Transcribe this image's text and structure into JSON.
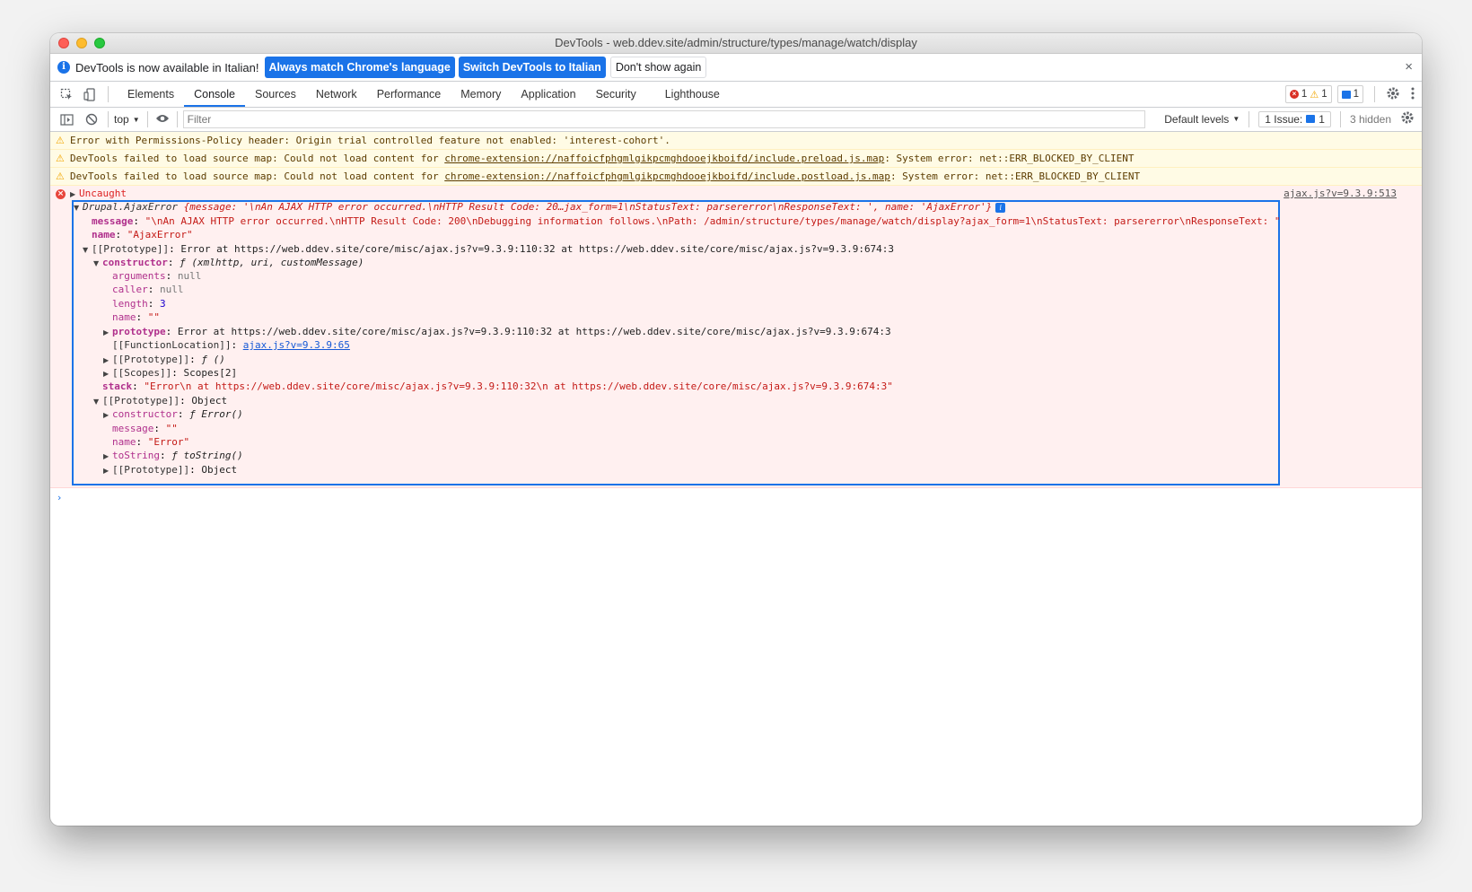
{
  "window": {
    "title": "DevTools - web.ddev.site/admin/structure/types/manage/watch/display"
  },
  "infobar": {
    "message": "DevTools is now available in Italian!",
    "btn_match": "Always match Chrome's language",
    "btn_switch": "Switch DevTools to Italian",
    "btn_dismiss": "Don't show again",
    "close": "×"
  },
  "tabs": [
    {
      "label": "Elements"
    },
    {
      "label": "Console"
    },
    {
      "label": "Sources"
    },
    {
      "label": "Network"
    },
    {
      "label": "Performance"
    },
    {
      "label": "Memory"
    },
    {
      "label": "Application"
    },
    {
      "label": "Security"
    },
    {
      "label": "Lighthouse"
    }
  ],
  "counters": {
    "errors": "1",
    "warnings": "1",
    "messages": "1"
  },
  "toolbar": {
    "context": "top",
    "filter_placeholder": "Filter",
    "levels": "Default levels",
    "issues_label": "1 Issue:",
    "issues_count": "1",
    "hidden": "3 hidden"
  },
  "warnings": [
    {
      "pre": "Error with Permissions-Policy header: Origin trial controlled feature not enabled: 'interest-cohort'.",
      "link": "",
      "post": ""
    },
    {
      "pre": "DevTools failed to load source map: Could not load content for ",
      "link": "chrome-extension://naffoicfphgmlgikpcmghdooejkboifd/include.preload.js.map",
      "post": ": System error: net::ERR_BLOCKED_BY_CLIENT"
    },
    {
      "pre": "DevTools failed to load source map: Could not load content for ",
      "link": "chrome-extension://naffoicfphgmlgikpcmghdooejkboifd/include.postload.js.map",
      "post": ": System error: net::ERR_BLOCKED_BY_CLIENT"
    }
  ],
  "error": {
    "label": "Uncaught",
    "source": "ajax.js?v=9.3.9:513",
    "summary_name": "Drupal.AjaxError",
    "summary_body": " {message: '\\nAn AJAX HTTP error occurred.\\nHTTP Result Code: 20…jax_form=1\\nStatusText: parsererror\\nResponseText: ', name: 'AjaxError'}",
    "message_key": "message",
    "message_val": "\"\\nAn AJAX HTTP error occurred.\\nHTTP Result Code: 200\\nDebugging information follows.\\nPath: /admin/structure/types/manage/watch/display?ajax_form=1\\nStatusText: parsererror\\nResponseText: \"",
    "name_key": "name",
    "name_val": "\"AjaxError\"",
    "proto_key": "[[Prototype]]",
    "proto_val": "Error at https://web.ddev.site/core/misc/ajax.js?v=9.3.9:110:32 at https://web.ddev.site/core/misc/ajax.js?v=9.3.9:674:3",
    "ctor_key": "constructor",
    "ctor_val": "ƒ (xmlhttp, uri, customMessage)",
    "arguments_key": "arguments",
    "arguments_val": "null",
    "caller_key": "caller",
    "caller_val": "null",
    "length_key": "length",
    "length_val": "3",
    "fname_key": "name",
    "fname_val": "\"\"",
    "prototype_key": "prototype",
    "prototype_val": "Error at https://web.ddev.site/core/misc/ajax.js?v=9.3.9:110:32 at https://web.ddev.site/core/misc/ajax.js?v=9.3.9:674:3",
    "funcloc_key": "[[FunctionLocation]]",
    "funcloc_val": "ajax.js?v=9.3.9:65",
    "fproto_key": "[[Prototype]]",
    "fproto_val": "ƒ ()",
    "scopes_key": "[[Scopes]]",
    "scopes_val": "Scopes[2]",
    "stack_key": "stack",
    "stack_val": "\"Error\\n    at https://web.ddev.site/core/misc/ajax.js?v=9.3.9:110:32\\n    at https://web.ddev.site/core/misc/ajax.js?v=9.3.9:674:3\"",
    "proto2_key": "[[Prototype]]",
    "proto2_val": "Object",
    "ctor2_key": "constructor",
    "ctor2_val": "ƒ Error()",
    "msg2_key": "message",
    "msg2_val": "\"\"",
    "name2_key": "name",
    "name2_val": "\"Error\"",
    "tostring_key": "toString",
    "tostring_val": "ƒ toString()",
    "proto3_key": "[[Prototype]]",
    "proto3_val": "Object"
  },
  "colors": {
    "accent": "#1a73e8",
    "error_bg": "#fff0f0",
    "warn_bg": "#fffbe5"
  },
  "icons": [
    "info-icon",
    "inspect-icon",
    "device-toolbar-icon",
    "settings-icon",
    "kebab-menu-icon",
    "sidebar-toggle-icon",
    "clear-console-icon",
    "eye-icon",
    "warning-icon",
    "error-icon"
  ]
}
